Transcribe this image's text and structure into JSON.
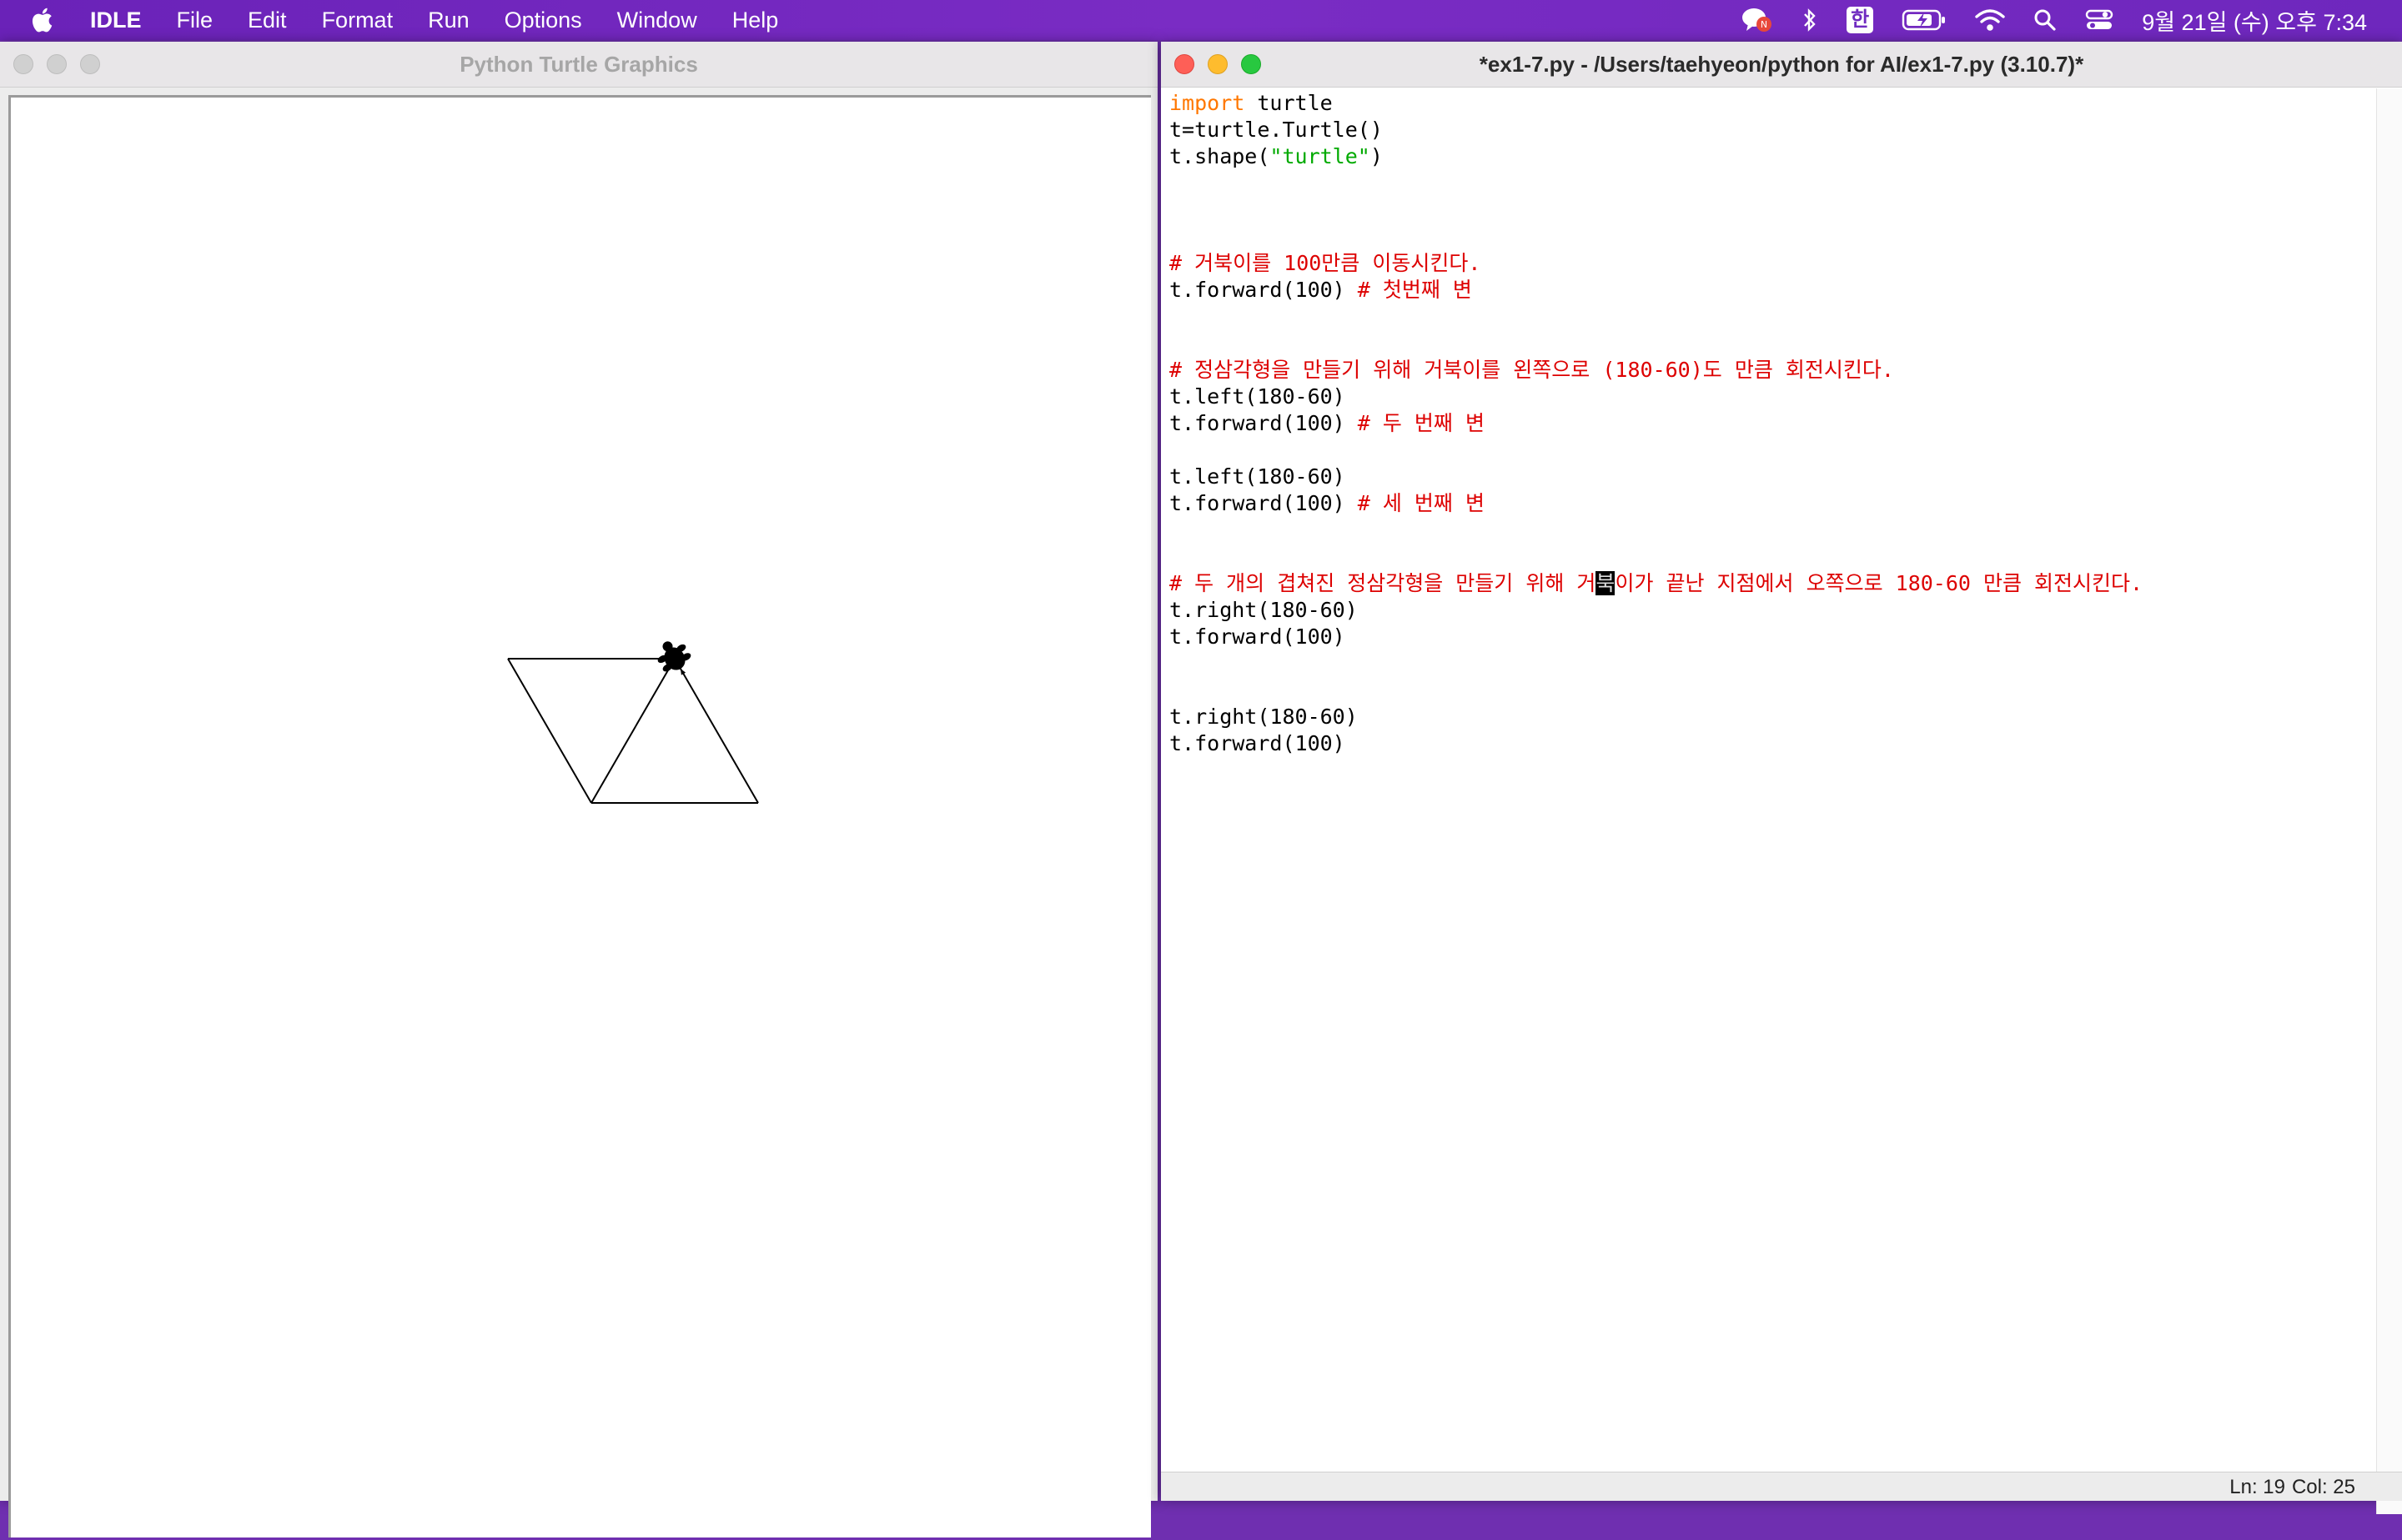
{
  "menubar": {
    "app_name": "IDLE",
    "items": [
      "File",
      "Edit",
      "Format",
      "Run",
      "Options",
      "Window",
      "Help"
    ],
    "input_method": "한",
    "clock": "9월 21일 (수) 오후 7:34"
  },
  "turtle_window": {
    "title": "Python Turtle Graphics"
  },
  "editor": {
    "title": "*ex1-7.py - /Users/taehyeon/python for AI/ex1-7.py (3.10.7)*",
    "lines": [
      {
        "code": "",
        "keyword": "import",
        "rest": " turtle",
        "comment": "",
        "kind": "kw"
      },
      {
        "code": "t=turtle.Turtle()",
        "comment": "",
        "kind": "plain"
      },
      {
        "code": "t.shape(",
        "string": "\"turtle\"",
        "after": ")",
        "comment": "",
        "kind": "str"
      },
      {
        "code": "",
        "comment": "",
        "kind": "blank"
      },
      {
        "code": "",
        "comment": "",
        "kind": "blank"
      },
      {
        "code": "",
        "comment": "",
        "kind": "blank"
      },
      {
        "code": "",
        "comment": "# 거북이를 100만큼 이동시킨다.",
        "kind": "comment"
      },
      {
        "code": "t.forward(100) ",
        "comment": "# 첫번째 변",
        "kind": "mixed"
      },
      {
        "code": "",
        "comment": "",
        "kind": "blank"
      },
      {
        "code": "",
        "comment": "",
        "kind": "blank"
      },
      {
        "code": "",
        "comment": "# 정삼각형을 만들기 위해 거북이를 왼쪽으로 (180-60)도 만큼 회전시킨다.",
        "kind": "comment"
      },
      {
        "code": "t.left(180-60)",
        "comment": "",
        "kind": "plain"
      },
      {
        "code": "t.forward(100) ",
        "comment": "# 두 번째 변",
        "kind": "mixed"
      },
      {
        "code": "",
        "comment": "",
        "kind": "blank"
      },
      {
        "code": "t.left(180-60)",
        "comment": "",
        "kind": "plain"
      },
      {
        "code": "t.forward(100) ",
        "comment": "# 세 번째 변",
        "kind": "mixed"
      },
      {
        "code": "",
        "comment": "",
        "kind": "blank"
      },
      {
        "code": "",
        "comment": "",
        "kind": "blank"
      },
      {
        "code": "",
        "comment": "# 두 개의 겹쳐진 정삼각형을 만들기 위해 거",
        "cursor": "북",
        "comment_after": "이가 끝난 지점에서 오쪽으로 180-60 만큼 회전시킨다.",
        "kind": "cursor-comment"
      },
      {
        "code": "t.right(180-60)",
        "comment": "",
        "kind": "plain"
      },
      {
        "code": "t.forward(100)",
        "comment": "",
        "kind": "plain"
      },
      {
        "code": "",
        "comment": "",
        "kind": "blank"
      },
      {
        "code": "",
        "comment": "",
        "kind": "blank"
      },
      {
        "code": "t.right(180-60)",
        "comment": "",
        "kind": "plain"
      },
      {
        "code": "t.forward(100)",
        "comment": "",
        "kind": "plain"
      }
    ],
    "status_ln": "Ln: 19",
    "status_col": "Col: 25"
  },
  "colors": {
    "menubar": "#7a2cc4",
    "keyword": "#ff7700",
    "string": "#00aa00",
    "comment": "#dd0000"
  }
}
